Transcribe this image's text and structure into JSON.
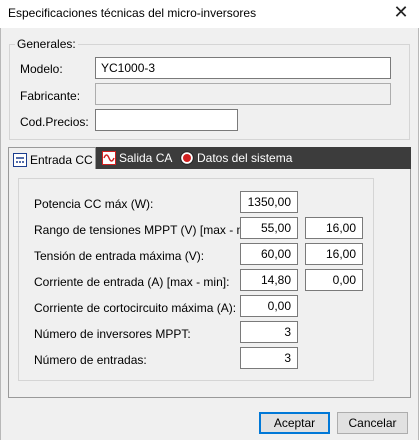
{
  "window": {
    "title": "Especificaciones técnicas del micro-inversores",
    "close_glyph": "✕"
  },
  "generales": {
    "legend": "Generales:",
    "modelo_label": "Modelo:",
    "modelo_value": "YC1000-3",
    "fabricante_label": "Fabricante:",
    "fabricante_value": "",
    "codprecios_label": "Cod.Precios:",
    "codprecios_value": ""
  },
  "tabs": [
    {
      "label": "Entrada CC",
      "icon": "dc-input-icon",
      "active": true
    },
    {
      "label": "Salida CA",
      "icon": "ac-wave-icon",
      "active": false
    },
    {
      "label": "Datos del sistema",
      "icon": "record-icon",
      "active": false
    }
  ],
  "fields": {
    "potencia": {
      "label": "Potencia CC máx (W):",
      "value": "1350,00"
    },
    "rango_mppt": {
      "label": "Rango de tensiones MPPT (V) [max - min]",
      "max": "55,00",
      "min": "16,00"
    },
    "tension_max": {
      "label": "Tensión de entrada máxima (V):",
      "value": "60,00",
      "value2": "16,00"
    },
    "corriente": {
      "label": "Corriente de entrada (A) [max - min]:",
      "max": "14,80",
      "min": "0,00"
    },
    "cortocircuito": {
      "label": "Corriente de cortocircuito máxima (A):",
      "value": "0,00"
    },
    "inversores_mppt": {
      "label": "Número de inversores MPPT:",
      "value": "3"
    },
    "entradas": {
      "label": "Número de entradas:",
      "value": "3"
    }
  },
  "buttons": {
    "accept": "Aceptar",
    "cancel": "Cancelar"
  },
  "colors": {
    "tabstrip": "#3c3c3c",
    "accent": "#0078d7",
    "ac_icon": "#d02020",
    "record_icon": "#d02020"
  }
}
